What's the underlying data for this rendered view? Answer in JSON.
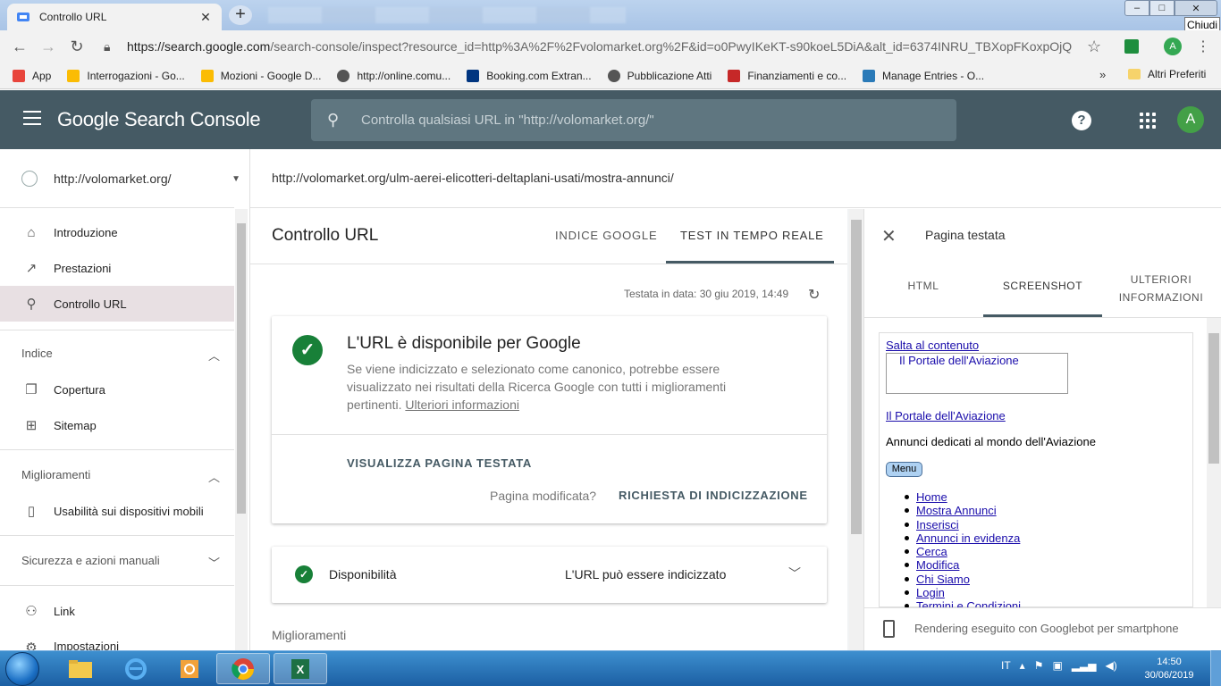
{
  "browser": {
    "tab_title": "Controllo URL",
    "tooltip": "Chiudi",
    "url_host": "https://search.google.com",
    "url_path": "/search-console/inspect?resource_id=http%3A%2F%2Fvolomarket.org%2F&id=o0PwyIKeKT-s90koeL5DiA&alt_id=6374INRU_TBXopFKoxpOjQ",
    "profile_initial": "A",
    "bookmarks": [
      {
        "label": "App",
        "icon": "apps-grid-icon",
        "color": "#e8453c"
      },
      {
        "label": "Interrogazioni - Go...",
        "icon": "google-drive-icon",
        "color": "#fbbc04"
      },
      {
        "label": "Mozioni - Google D...",
        "icon": "google-drive-icon",
        "color": "#fbbc04"
      },
      {
        "label": "http://online.comu...",
        "icon": "globe-icon",
        "color": "#555555"
      },
      {
        "label": "Booking.com Extran...",
        "icon": "booking-icon",
        "color": "#003580"
      },
      {
        "label": "Pubblicazione Atti",
        "icon": "globe-icon",
        "color": "#555555"
      },
      {
        "label": "Finanziamenti e co...",
        "icon": "flag-icon",
        "color": "#c62828"
      },
      {
        "label": "Manage Entries - O...",
        "icon": "site-icon",
        "color": "#2a7ab8"
      }
    ],
    "bookmarks_more": "»",
    "bookmarks_other": "Altri Preferiti"
  },
  "header": {
    "brand": "Google Search Console",
    "search_placeholder": "Controlla qualsiasi URL in \"http://volomarket.org/\"",
    "avatar_initial": "A",
    "bg_color": "#455a64"
  },
  "sidebar": {
    "property": "http://volomarket.org/",
    "items_top": [
      {
        "label": "Introduzione",
        "icon": "home-icon"
      },
      {
        "label": "Prestazioni",
        "icon": "trend-icon"
      },
      {
        "label": "Controllo URL",
        "icon": "search-icon",
        "active": true
      }
    ],
    "section_index": "Indice",
    "items_index": [
      {
        "label": "Copertura",
        "icon": "copy-icon"
      },
      {
        "label": "Sitemap",
        "icon": "sitemap-icon"
      }
    ],
    "section_improvements": "Miglioramenti",
    "items_improvements": [
      {
        "label": "Usabilità sui dispositivi mobili",
        "icon": "phone-icon"
      }
    ],
    "section_security": "Sicurezza e azioni manuali",
    "items_bottom": [
      {
        "label": "Link",
        "icon": "link-icon"
      },
      {
        "label": "Impostazioni",
        "icon": "settings-icon"
      }
    ]
  },
  "main": {
    "inspected_url": "http://volomarket.org/ulm-aerei-elicotteri-deltaplani-usati/mostra-annunci/",
    "title": "Controllo URL",
    "tabs": [
      {
        "label": "INDICE GOOGLE"
      },
      {
        "label": "TEST IN TEMPO REALE",
        "active": true
      }
    ],
    "tested_at": "Testata in data: 30 giu 2019, 14:49",
    "result_title": "L'URL è disponibile per Google",
    "result_desc": "Se viene indicizzato e selezionato come canonico, potrebbe essere visualizzato nei risultati della Ricerca Google con tutti i miglioramenti pertinenti.",
    "result_link": "Ulteriori informazioni",
    "view_tested": "VISUALIZZA PAGINA TESTATA",
    "page_modified": "Pagina modificata?",
    "request_index": "RICHIESTA DI INDICIZZAZIONE",
    "availability_label": "Disponibilità",
    "availability_value": "L'URL può essere indicizzato",
    "improvements_heading": "Miglioramenti"
  },
  "panel": {
    "title": "Pagina testata",
    "tabs": [
      {
        "label": "HTML"
      },
      {
        "label": "SCREENSHOT",
        "active": true
      },
      {
        "label": "ULTERIORI INFORMAZIONI"
      }
    ],
    "screenshot": {
      "skip_link": "Salta al contenuto",
      "logo_alt": "Il Portale dell'Aviazione",
      "site_link": "Il Portale dell'Aviazione",
      "tagline": "Annunci dedicati al mondo dell'Aviazione",
      "menu_button": "Menu",
      "menu_items": [
        "Home",
        "Mostra Annunci",
        "Inserisci",
        "Annunci in evidenza",
        "Cerca",
        "Modifica",
        "Chi Siamo",
        "Login",
        "Termini e Condizioni"
      ]
    },
    "footer": "Rendering eseguito con Googlebot per smartphone"
  },
  "taskbar": {
    "language": "IT",
    "time": "14:50",
    "date": "30/06/2019"
  }
}
